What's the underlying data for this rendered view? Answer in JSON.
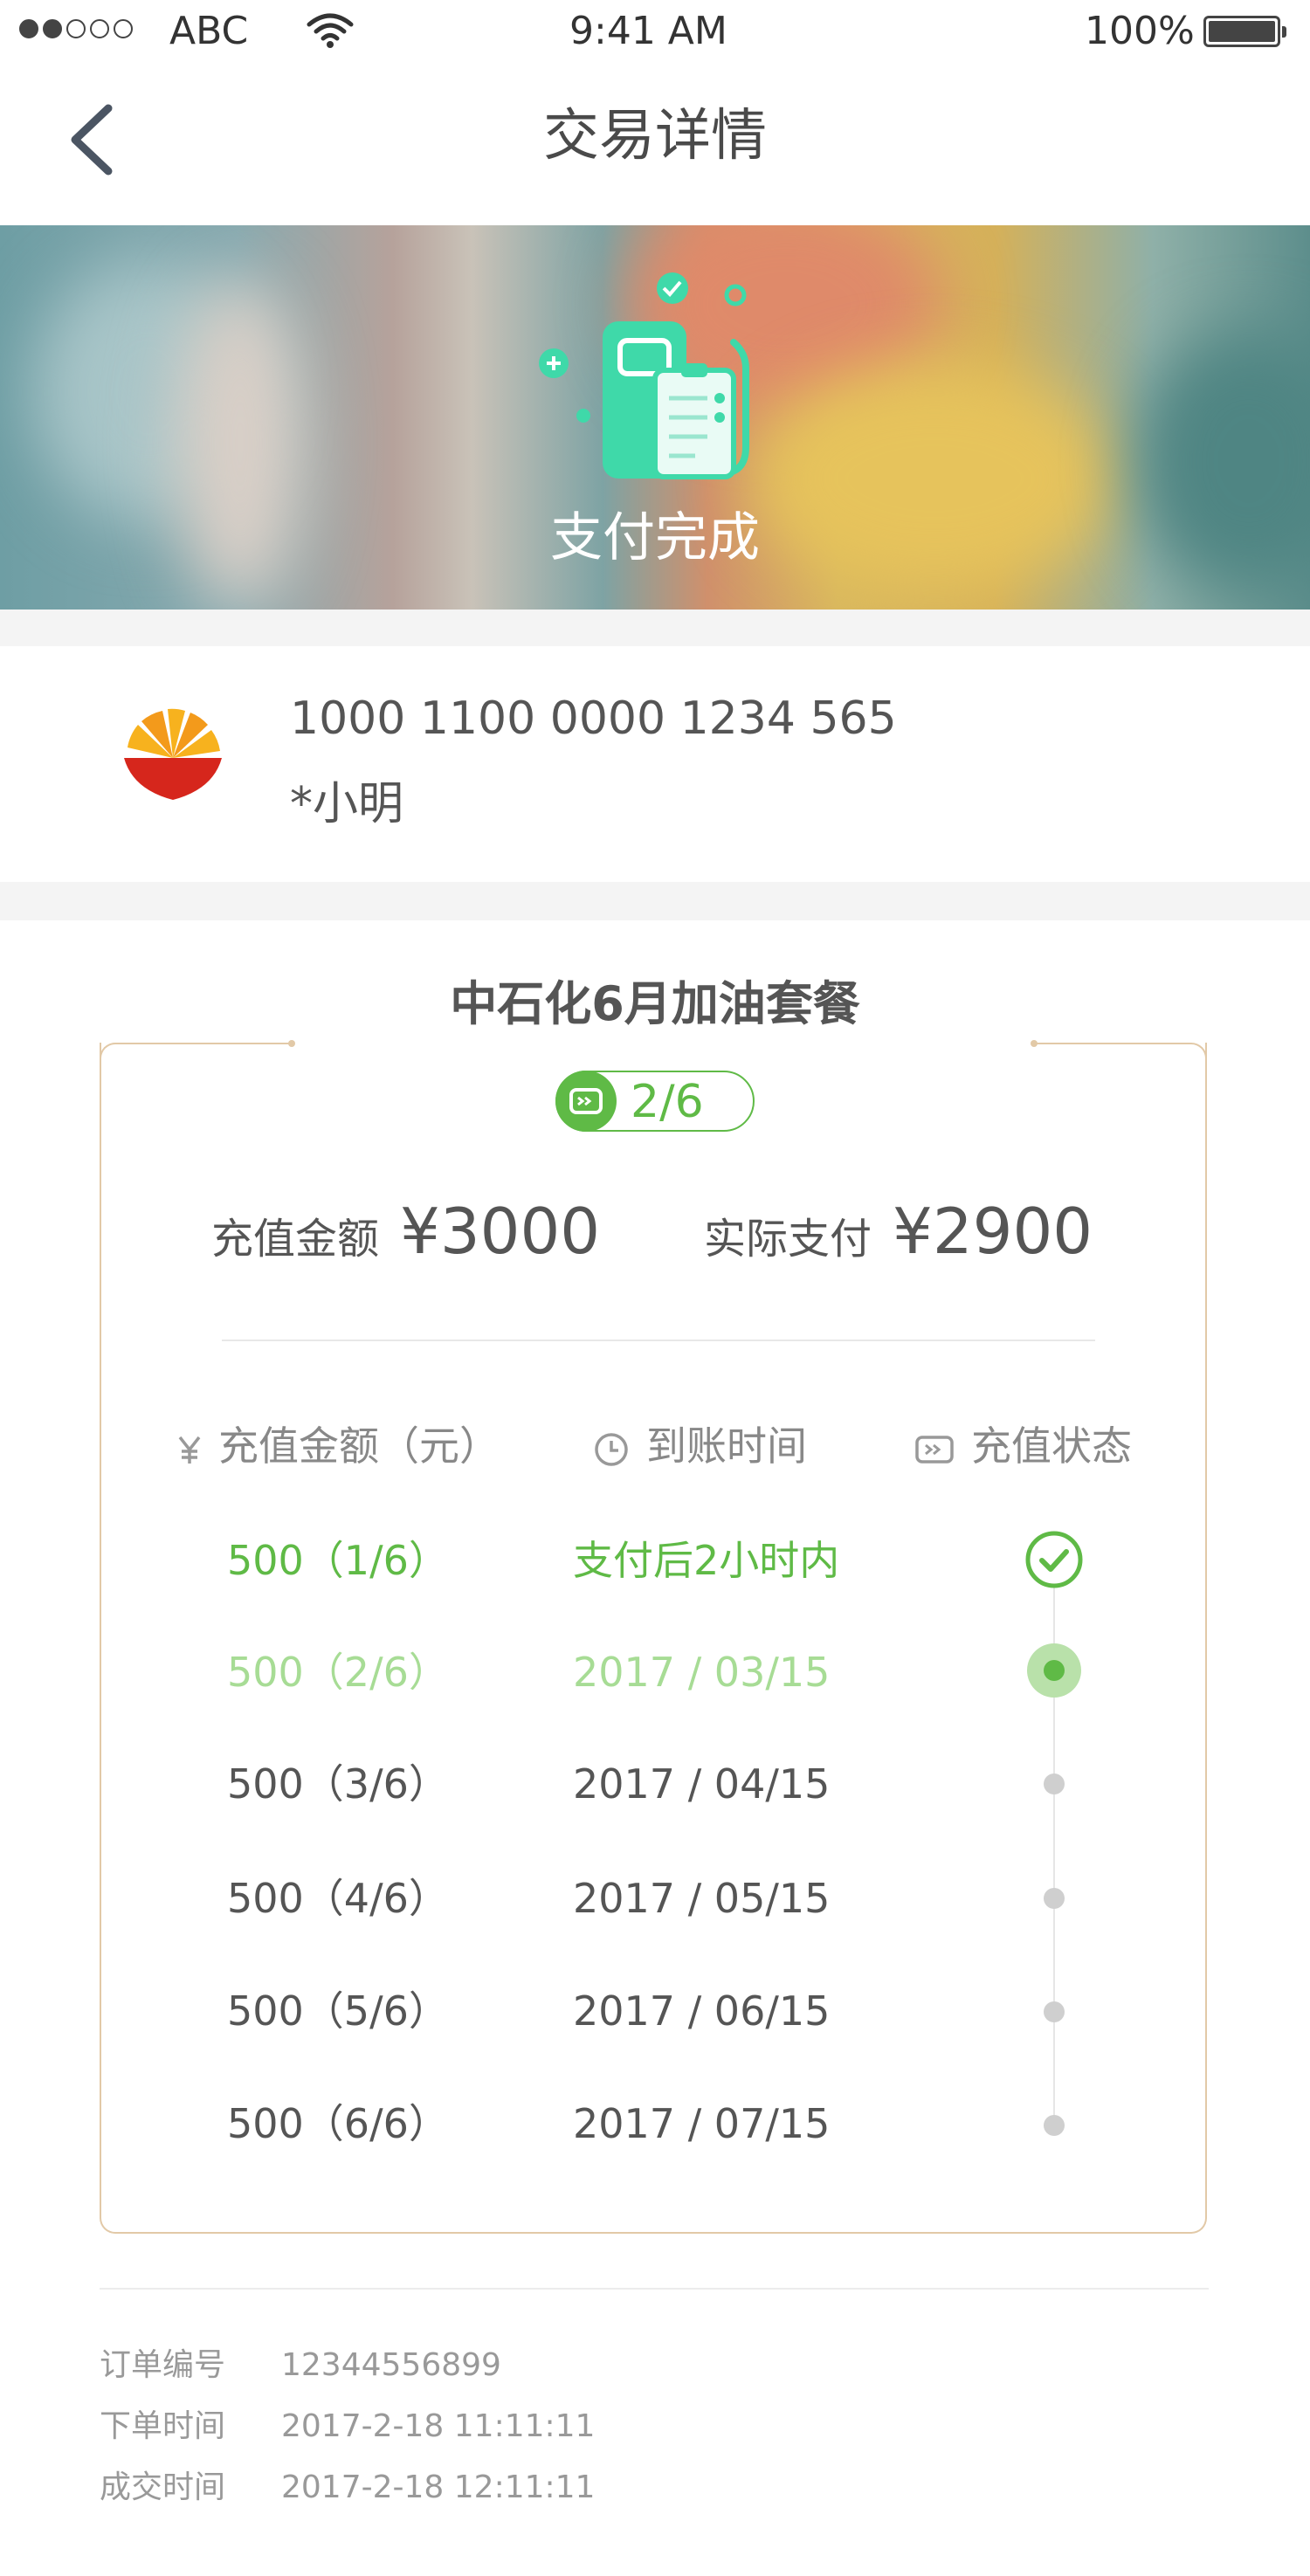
{
  "status_bar": {
    "carrier": "ABC",
    "time": "9:41 AM",
    "battery": "100%"
  },
  "nav": {
    "title": "交易详情"
  },
  "banner": {
    "status_text": "支付完成"
  },
  "account": {
    "card_number": "1000 1100 0000 1234 565",
    "holder": "*小明"
  },
  "plan": {
    "title": "中石化6月加油套餐",
    "progress": "2/6",
    "recharge_label": "充值金额",
    "recharge_value": "¥3000",
    "paid_label": "实际支付",
    "paid_value": "¥2900",
    "headers": {
      "amount": "充值金额（元）",
      "arrival": "到账时间",
      "status": "充值状态"
    },
    "rows": [
      {
        "amount": "500（1/6）",
        "date": "支付后2小时内",
        "state": "done"
      },
      {
        "amount": "500（2/6）",
        "date": "2017 / 03/15",
        "state": "current"
      },
      {
        "amount": "500（3/6）",
        "date": "2017 / 04/15",
        "state": "pending"
      },
      {
        "amount": "500（4/6）",
        "date": "2017 / 05/15",
        "state": "pending"
      },
      {
        "amount": "500（5/6）",
        "date": "2017 / 06/15",
        "state": "pending"
      },
      {
        "amount": "500（6/6）",
        "date": "2017 / 07/15",
        "state": "pending"
      }
    ]
  },
  "order": {
    "number_label": "订单编号",
    "number": "12344556899",
    "placed_label": "下单时间",
    "placed": "2017-2-18 11:11:11",
    "done_label": "成交时间",
    "done": "2017-2-18 12:11:11"
  },
  "colors": {
    "accent_green": "#5fba46",
    "light_green": "#a7dc95",
    "frame_gold": "#e2c9a7",
    "icon_teal": "#3fd9a9"
  },
  "icons": [
    "signal-dots-icon",
    "wifi-icon",
    "battery-icon",
    "back-arrow-icon",
    "fuel-pump-icon",
    "petrochina-logo",
    "ticket-icon",
    "yen-icon",
    "clock-icon",
    "check-circle-icon"
  ]
}
